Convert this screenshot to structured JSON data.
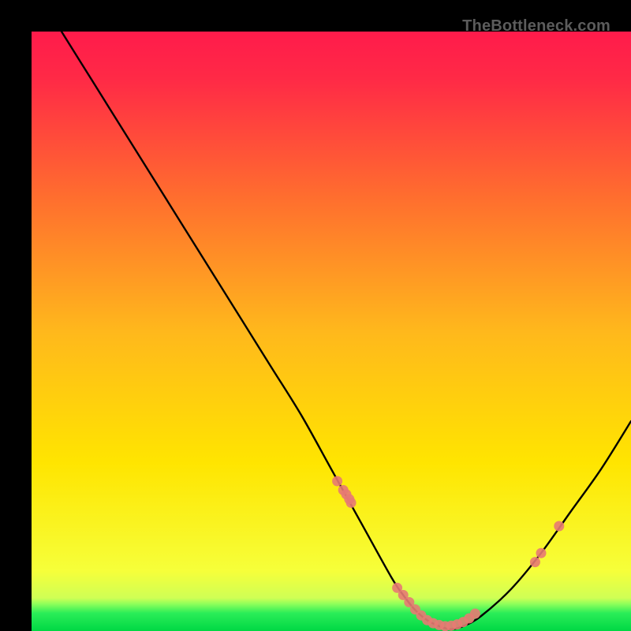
{
  "watermark": "TheBottleneck.com",
  "chart_data": {
    "type": "line",
    "title": "",
    "xlabel": "",
    "ylabel": "",
    "xlim": [
      0,
      100
    ],
    "ylim": [
      0,
      100
    ],
    "grid": false,
    "legend": false,
    "background_gradient": {
      "top": "#ff1b4b",
      "mid": "#ffd300",
      "green_band_start_y": 5,
      "bottom": "#00e04a"
    },
    "series": [
      {
        "name": "bottleneck-curve",
        "color": "#000000",
        "type": "line",
        "x": [
          5,
          10,
          15,
          20,
          25,
          30,
          35,
          40,
          45,
          50,
          55,
          60,
          62,
          64,
          66,
          68,
          70,
          72,
          75,
          80,
          85,
          90,
          95,
          100
        ],
        "y": [
          100,
          92,
          84,
          76,
          68,
          60,
          52,
          44,
          36,
          27,
          18,
          9,
          6,
          3.5,
          1.8,
          0.8,
          0.3,
          0.8,
          2.5,
          7,
          13,
          20,
          27,
          35
        ]
      },
      {
        "name": "sample-points",
        "color": "#e77a73",
        "type": "scatter",
        "x": [
          51,
          52,
          52.5,
          53,
          53.3,
          61,
          62,
          63,
          64,
          65,
          66,
          67,
          68,
          69,
          70,
          71,
          72,
          73,
          74,
          84,
          85,
          88
        ],
        "y": [
          25,
          23.5,
          22.8,
          22,
          21.4,
          7.2,
          6.0,
          4.8,
          3.6,
          2.6,
          1.8,
          1.3,
          1.0,
          0.8,
          0.9,
          1.1,
          1.5,
          2.1,
          2.9,
          11.5,
          13.0,
          17.5
        ]
      }
    ]
  }
}
